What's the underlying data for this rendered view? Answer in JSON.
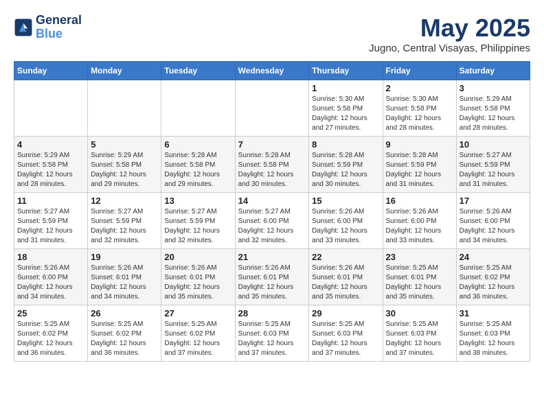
{
  "header": {
    "logo_line1": "General",
    "logo_line2": "Blue",
    "title": "May 2025",
    "subtitle": "Jugno, Central Visayas, Philippines"
  },
  "weekdays": [
    "Sunday",
    "Monday",
    "Tuesday",
    "Wednesday",
    "Thursday",
    "Friday",
    "Saturday"
  ],
  "weeks": [
    [
      {
        "day": "",
        "info": ""
      },
      {
        "day": "",
        "info": ""
      },
      {
        "day": "",
        "info": ""
      },
      {
        "day": "",
        "info": ""
      },
      {
        "day": "1",
        "info": "Sunrise: 5:30 AM\nSunset: 5:58 PM\nDaylight: 12 hours\nand 27 minutes."
      },
      {
        "day": "2",
        "info": "Sunrise: 5:30 AM\nSunset: 5:58 PM\nDaylight: 12 hours\nand 28 minutes."
      },
      {
        "day": "3",
        "info": "Sunrise: 5:29 AM\nSunset: 5:58 PM\nDaylight: 12 hours\nand 28 minutes."
      }
    ],
    [
      {
        "day": "4",
        "info": "Sunrise: 5:29 AM\nSunset: 5:58 PM\nDaylight: 12 hours\nand 28 minutes."
      },
      {
        "day": "5",
        "info": "Sunrise: 5:29 AM\nSunset: 5:58 PM\nDaylight: 12 hours\nand 29 minutes."
      },
      {
        "day": "6",
        "info": "Sunrise: 5:28 AM\nSunset: 5:58 PM\nDaylight: 12 hours\nand 29 minutes."
      },
      {
        "day": "7",
        "info": "Sunrise: 5:28 AM\nSunset: 5:58 PM\nDaylight: 12 hours\nand 30 minutes."
      },
      {
        "day": "8",
        "info": "Sunrise: 5:28 AM\nSunset: 5:59 PM\nDaylight: 12 hours\nand 30 minutes."
      },
      {
        "day": "9",
        "info": "Sunrise: 5:28 AM\nSunset: 5:59 PM\nDaylight: 12 hours\nand 31 minutes."
      },
      {
        "day": "10",
        "info": "Sunrise: 5:27 AM\nSunset: 5:59 PM\nDaylight: 12 hours\nand 31 minutes."
      }
    ],
    [
      {
        "day": "11",
        "info": "Sunrise: 5:27 AM\nSunset: 5:59 PM\nDaylight: 12 hours\nand 31 minutes."
      },
      {
        "day": "12",
        "info": "Sunrise: 5:27 AM\nSunset: 5:59 PM\nDaylight: 12 hours\nand 32 minutes."
      },
      {
        "day": "13",
        "info": "Sunrise: 5:27 AM\nSunset: 5:59 PM\nDaylight: 12 hours\nand 32 minutes."
      },
      {
        "day": "14",
        "info": "Sunrise: 5:27 AM\nSunset: 6:00 PM\nDaylight: 12 hours\nand 32 minutes."
      },
      {
        "day": "15",
        "info": "Sunrise: 5:26 AM\nSunset: 6:00 PM\nDaylight: 12 hours\nand 33 minutes."
      },
      {
        "day": "16",
        "info": "Sunrise: 5:26 AM\nSunset: 6:00 PM\nDaylight: 12 hours\nand 33 minutes."
      },
      {
        "day": "17",
        "info": "Sunrise: 5:26 AM\nSunset: 6:00 PM\nDaylight: 12 hours\nand 34 minutes."
      }
    ],
    [
      {
        "day": "18",
        "info": "Sunrise: 5:26 AM\nSunset: 6:00 PM\nDaylight: 12 hours\nand 34 minutes."
      },
      {
        "day": "19",
        "info": "Sunrise: 5:26 AM\nSunset: 6:01 PM\nDaylight: 12 hours\nand 34 minutes."
      },
      {
        "day": "20",
        "info": "Sunrise: 5:26 AM\nSunset: 6:01 PM\nDaylight: 12 hours\nand 35 minutes."
      },
      {
        "day": "21",
        "info": "Sunrise: 5:26 AM\nSunset: 6:01 PM\nDaylight: 12 hours\nand 35 minutes."
      },
      {
        "day": "22",
        "info": "Sunrise: 5:26 AM\nSunset: 6:01 PM\nDaylight: 12 hours\nand 35 minutes."
      },
      {
        "day": "23",
        "info": "Sunrise: 5:25 AM\nSunset: 6:01 PM\nDaylight: 12 hours\nand 35 minutes."
      },
      {
        "day": "24",
        "info": "Sunrise: 5:25 AM\nSunset: 6:02 PM\nDaylight: 12 hours\nand 36 minutes."
      }
    ],
    [
      {
        "day": "25",
        "info": "Sunrise: 5:25 AM\nSunset: 6:02 PM\nDaylight: 12 hours\nand 36 minutes."
      },
      {
        "day": "26",
        "info": "Sunrise: 5:25 AM\nSunset: 6:02 PM\nDaylight: 12 hours\nand 36 minutes."
      },
      {
        "day": "27",
        "info": "Sunrise: 5:25 AM\nSunset: 6:02 PM\nDaylight: 12 hours\nand 37 minutes."
      },
      {
        "day": "28",
        "info": "Sunrise: 5:25 AM\nSunset: 6:03 PM\nDaylight: 12 hours\nand 37 minutes."
      },
      {
        "day": "29",
        "info": "Sunrise: 5:25 AM\nSunset: 6:03 PM\nDaylight: 12 hours\nand 37 minutes."
      },
      {
        "day": "30",
        "info": "Sunrise: 5:25 AM\nSunset: 6:03 PM\nDaylight: 12 hours\nand 37 minutes."
      },
      {
        "day": "31",
        "info": "Sunrise: 5:25 AM\nSunset: 6:03 PM\nDaylight: 12 hours\nand 38 minutes."
      }
    ]
  ]
}
